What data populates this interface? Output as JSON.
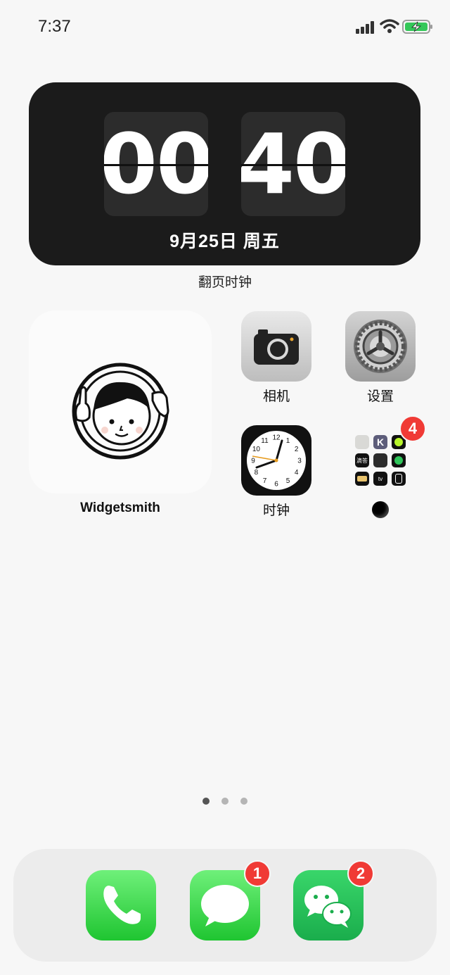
{
  "status_bar": {
    "time": "7:37"
  },
  "flip_clock": {
    "hours": "00",
    "minutes": "40",
    "date": "9月25日 周五",
    "caption": "翻页时钟"
  },
  "widgetsmith": {
    "label": "Widgetsmith"
  },
  "apps": {
    "camera": {
      "label": "相机"
    },
    "settings": {
      "label": "设置"
    },
    "clock": {
      "label": "时钟",
      "dial_numbers": [
        "12",
        "1",
        "2",
        "3",
        "4",
        "5",
        "6",
        "7",
        "8",
        "9",
        "10",
        "11"
      ]
    },
    "folder": {
      "badge": "4",
      "mini_apps": [
        "contacts",
        "K",
        "green",
        "滴答",
        "calculator",
        "find-my",
        "wallet",
        "tv",
        "watch"
      ]
    }
  },
  "page_indicator": {
    "count": 3,
    "active": 0
  },
  "dock": {
    "phone": {},
    "messages": {
      "badge": "1"
    },
    "wechat": {
      "badge": "2"
    }
  },
  "colors": {
    "badge_red": "#f03a35",
    "widget_dark": "#1b1b1b",
    "app_green": "#1fc531"
  }
}
